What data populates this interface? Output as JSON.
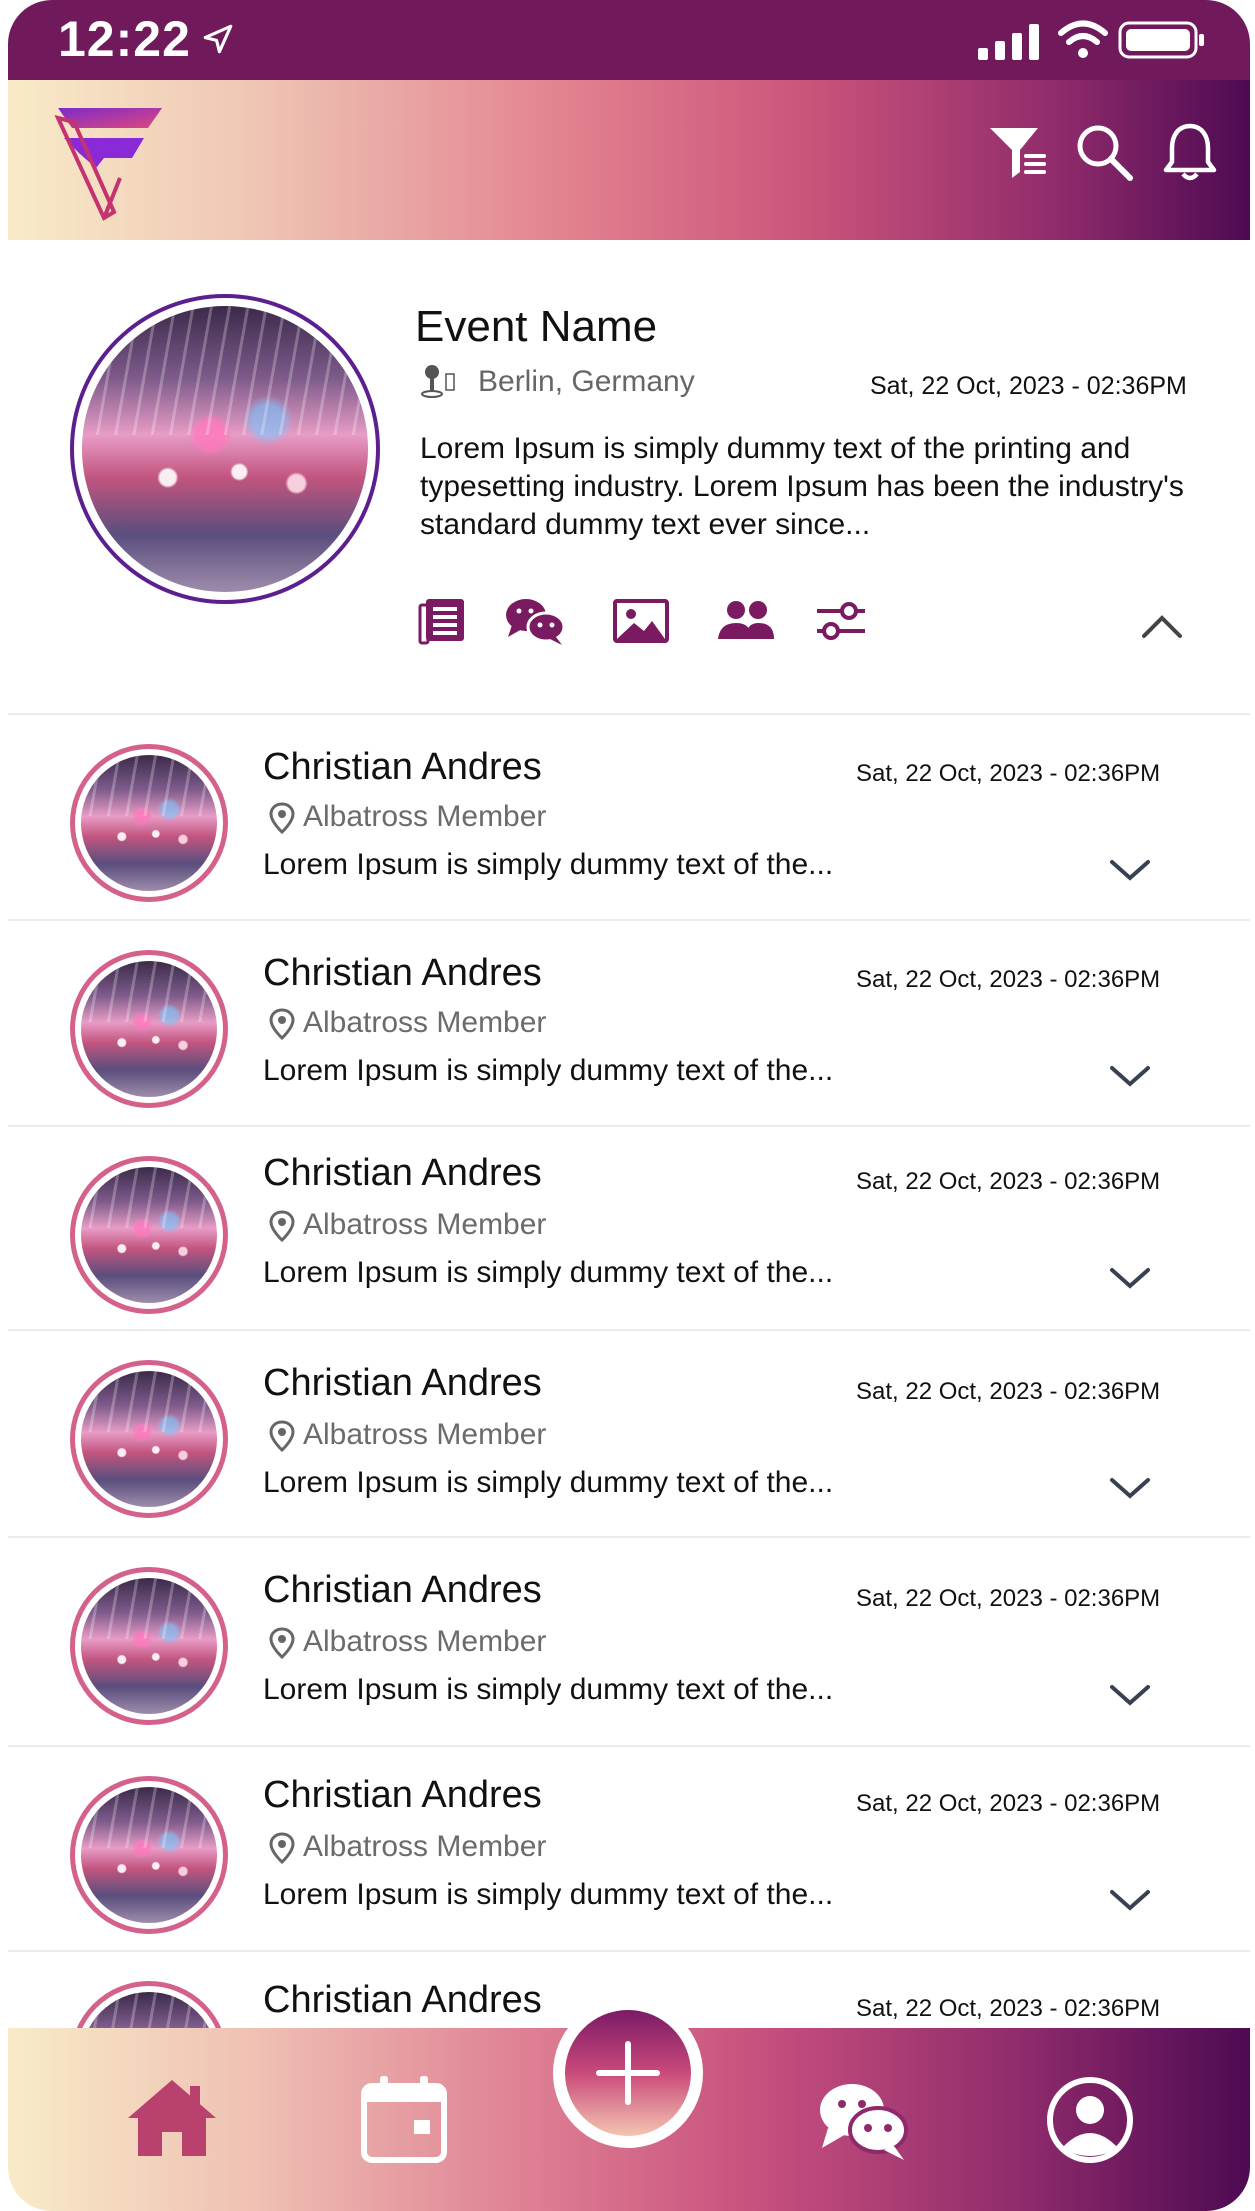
{
  "status_bar": {
    "time": "12:22"
  },
  "header": {
    "icons": [
      "filter-icon",
      "search-icon",
      "bell-icon"
    ]
  },
  "event": {
    "name": "Event Name",
    "location": "Berlin, Germany",
    "date": "Sat, 22 Oct, 2023 - 02:36PM",
    "description": "Lorem Ipsum is simply dummy text of the printing and typesetting industry. Lorem Ipsum has been the industry's standard dummy text ever since...",
    "actions": [
      "news-icon",
      "chat-icon",
      "gallery-icon",
      "members-icon",
      "settings-sliders-icon"
    ]
  },
  "members": [
    {
      "name": "Christian Andres",
      "role": "Albatross Member",
      "date": "Sat, 22 Oct, 2023 - 02:36PM",
      "text": "Lorem Ipsum is simply dummy text of the..."
    },
    {
      "name": "Christian Andres",
      "role": "Albatross Member",
      "date": "Sat, 22 Oct, 2023 - 02:36PM",
      "text": "Lorem Ipsum is simply dummy text of the..."
    },
    {
      "name": "Christian Andres",
      "role": "Albatross Member",
      "date": "Sat, 22 Oct, 2023 - 02:36PM",
      "text": "Lorem Ipsum is simply dummy text of the..."
    },
    {
      "name": "Christian Andres",
      "role": "Albatross Member",
      "date": "Sat, 22 Oct, 2023 - 02:36PM",
      "text": "Lorem Ipsum is simply dummy text of the..."
    },
    {
      "name": "Christian Andres",
      "role": "Albatross Member",
      "date": "Sat, 22 Oct, 2023 - 02:36PM",
      "text": "Lorem Ipsum is simply dummy text of the..."
    },
    {
      "name": "Christian Andres",
      "role": "Albatross Member",
      "date": "Sat, 22 Oct, 2023 - 02:36PM",
      "text": "Lorem Ipsum is simply dummy text of the..."
    },
    {
      "name": "Christian Andres",
      "role": "",
      "date": "Sat, 22 Oct, 2023 - 02:36PM",
      "text": ""
    }
  ],
  "tab_bar": {
    "tabs": [
      "home-icon",
      "calendar-icon",
      "add-icon",
      "chat-icon",
      "profile-icon"
    ]
  },
  "colors": {
    "primary": "#701a5c",
    "accent_pink": "#d4618c",
    "purple_dark": "#4d0a52",
    "cream": "#f8ebc8"
  }
}
